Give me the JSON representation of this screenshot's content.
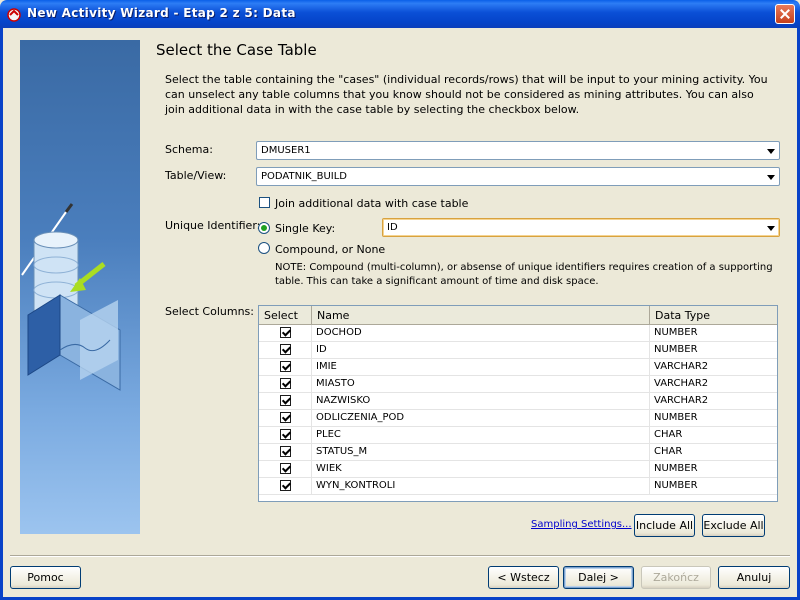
{
  "window": {
    "title": "New Activity Wizard - Etap 2 z 5: Data"
  },
  "page": {
    "heading": "Select the Case Table",
    "description": "Select the table containing the \"cases\" (individual records/rows) that will be input to your mining activity.  You can unselect any table columns that you know should not be considered as mining attributes.  You can also join additional data in with the case table by selecting the checkbox below."
  },
  "form": {
    "schema_label": "Schema:",
    "schema_value": "DMUSER1",
    "table_label": "Table/View:",
    "table_value": "PODATNIK_BUILD",
    "join_label": "Join additional data with case table",
    "join_checked": false,
    "uid_label": "Unique Identifier:",
    "single_key_label": "Single Key:",
    "single_key_value": "ID",
    "compound_label": "Compound, or None",
    "note": "NOTE: Compound (multi-column), or absense of unique identifiers requires creation of a supporting table. This can take a significant amount of time and disk space.",
    "select_columns_label": "Select Columns:"
  },
  "table": {
    "headers": [
      "Select",
      "Name",
      "Data Type"
    ],
    "rows": [
      {
        "name": "DOCHOD",
        "type": "NUMBER",
        "selected": true
      },
      {
        "name": "ID",
        "type": "NUMBER",
        "selected": true
      },
      {
        "name": "IMIE",
        "type": "VARCHAR2",
        "selected": true
      },
      {
        "name": "MIASTO",
        "type": "VARCHAR2",
        "selected": true
      },
      {
        "name": "NAZWISKO",
        "type": "VARCHAR2",
        "selected": true
      },
      {
        "name": "ODLICZENIA_POD",
        "type": "NUMBER",
        "selected": true
      },
      {
        "name": "PLEC",
        "type": "CHAR",
        "selected": true
      },
      {
        "name": "STATUS_M",
        "type": "CHAR",
        "selected": true
      },
      {
        "name": "WIEK",
        "type": "NUMBER",
        "selected": true
      },
      {
        "name": "WYN_KONTROLI",
        "type": "NUMBER",
        "selected": true
      }
    ]
  },
  "actions": {
    "sampling_link": "Sampling Settings...",
    "include_all": "Include All",
    "exclude_all": "Exclude All"
  },
  "footer": {
    "help": "Pomoc",
    "back": "< Wstecz",
    "next": "Dalej >",
    "finish": "Zakończ",
    "cancel": "Anuluj"
  }
}
